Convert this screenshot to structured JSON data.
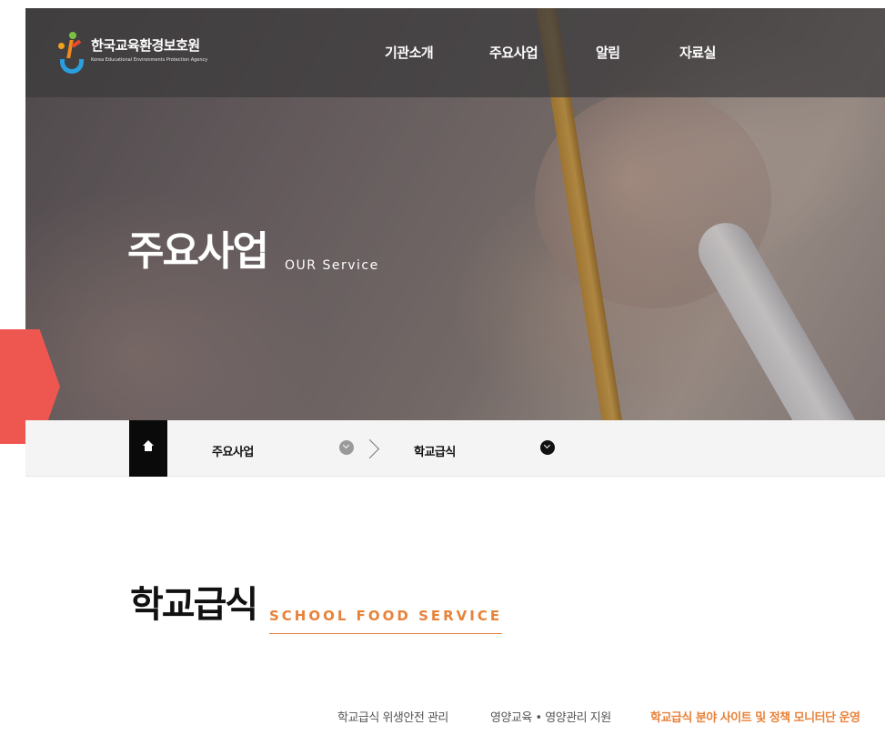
{
  "header": {
    "org_name": "한국교육환경보호원",
    "org_sub": "Korea Educational Environments Protection Agency",
    "nav": [
      "기관소개",
      "주요사업",
      "알림",
      "자료실"
    ]
  },
  "hero": {
    "title": "주요사업",
    "subtitle": "OUR Service"
  },
  "breadcrumb": {
    "level1": "주요사업",
    "level2": "학교급식"
  },
  "section": {
    "title": "학교급식",
    "subtitle": "SCHOOL FOOD SERVICE"
  },
  "tabs": [
    {
      "label": "학교급식 위생안전 관리",
      "active": false
    },
    {
      "label": "영양교육 • 영양관리 지원",
      "active": false
    },
    {
      "label": "학교급식 분야 사이트 및 정책 모니터단 운영",
      "active": true
    }
  ],
  "colors": {
    "accent": "#e8823a",
    "red_accent": "#ee5650",
    "home_bg": "#0a0a0a",
    "chevron_grey": "#9a9a9a",
    "chevron_dark": "#111111"
  },
  "icons": {
    "home": "home-icon",
    "dropdown": "chevron-down-icon",
    "separator": "chevron-right-icon"
  }
}
